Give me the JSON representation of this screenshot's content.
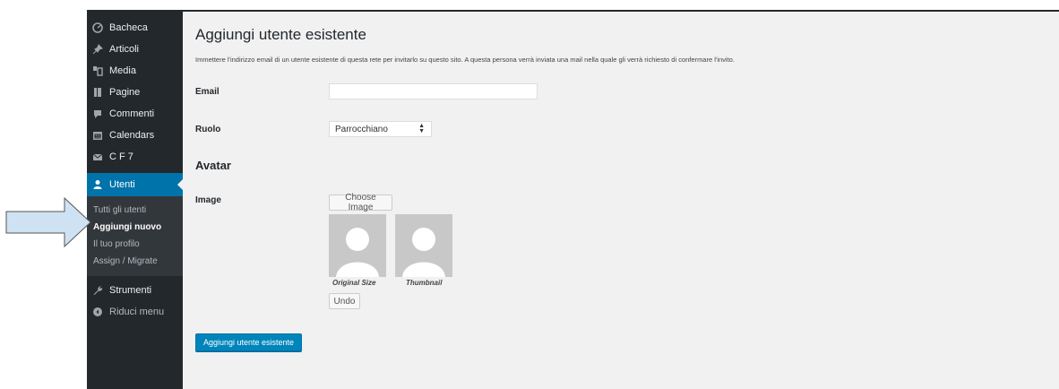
{
  "sidebar": {
    "items": [
      {
        "label": "Bacheca",
        "icon": "dashboard-icon"
      },
      {
        "label": "Articoli",
        "icon": "pin-icon"
      },
      {
        "label": "Media",
        "icon": "media-icon"
      },
      {
        "label": "Pagine",
        "icon": "pages-icon"
      },
      {
        "label": "Commenti",
        "icon": "comment-icon"
      },
      {
        "label": "Calendars",
        "icon": "calendar-icon"
      },
      {
        "label": "C F 7",
        "icon": "mail-icon"
      }
    ],
    "active": {
      "label": "Utenti",
      "icon": "user-icon"
    },
    "submenu": [
      "Tutti gli utenti",
      "Aggiungi nuovo",
      "Il tuo profilo",
      "Assign / Migrate"
    ],
    "submenu_current": "Aggiungi nuovo",
    "tools": {
      "label": "Strumenti",
      "icon": "wrench-icon"
    },
    "collapse": {
      "label": "Riduci menu",
      "icon": "collapse-icon"
    }
  },
  "main": {
    "title": "Aggiungi utente esistente",
    "intro": "Immettere l'indirizzo email di un utente esistente di questa rete per invitarlo su questo sito. A questa persona verrà inviata una mail nella quale gli verrà richiesto di confermare l'invito.",
    "email_label": "Email",
    "email_value": "",
    "role_label": "Ruolo",
    "role_value": "Parrocchiano",
    "avatar_heading": "Avatar",
    "image_label": "Image",
    "choose_button": "Choose Image",
    "original_caption": "Original Size",
    "thumbnail_caption": "Thumbnail",
    "undo_button": "Undo",
    "submit_button": "Aggiungi utente esistente"
  },
  "colors": {
    "sidebar_bg": "#23282d",
    "submenu_bg": "#32373c",
    "active_bg": "#0073aa",
    "content_bg": "#f1f1f1",
    "primary_button": "#0085ba",
    "annotation_arrow": "#cfe2f3"
  }
}
